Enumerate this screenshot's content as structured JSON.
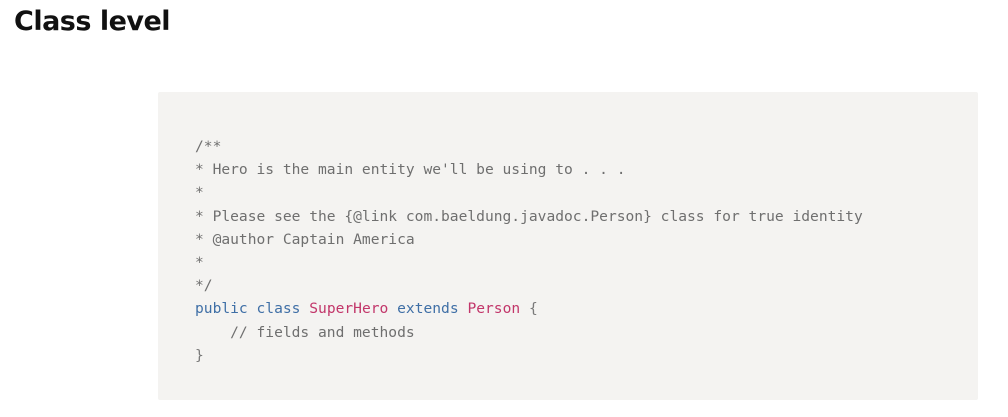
{
  "heading": "Class level",
  "code": {
    "comment_lines": [
      "/**",
      "* Hero is the main entity we'll be using to . . .",
      "*",
      "* Please see the {@link com.baeldung.javadoc.Person} class for true identity",
      "* @author Captain America",
      "*",
      "*/"
    ],
    "decl": {
      "kw_public": "public",
      "kw_class": "class",
      "class_name": "SuperHero",
      "kw_extends": "extends",
      "parent_name": "Person",
      "open_brace": "{"
    },
    "body_comment": "    // fields and methods",
    "close_brace": "}"
  },
  "colors": {
    "code_background": "#f4f3f1",
    "keyword": "#3f6fa6",
    "type_name": "#c2366a",
    "comment": "#6f6f6f"
  }
}
